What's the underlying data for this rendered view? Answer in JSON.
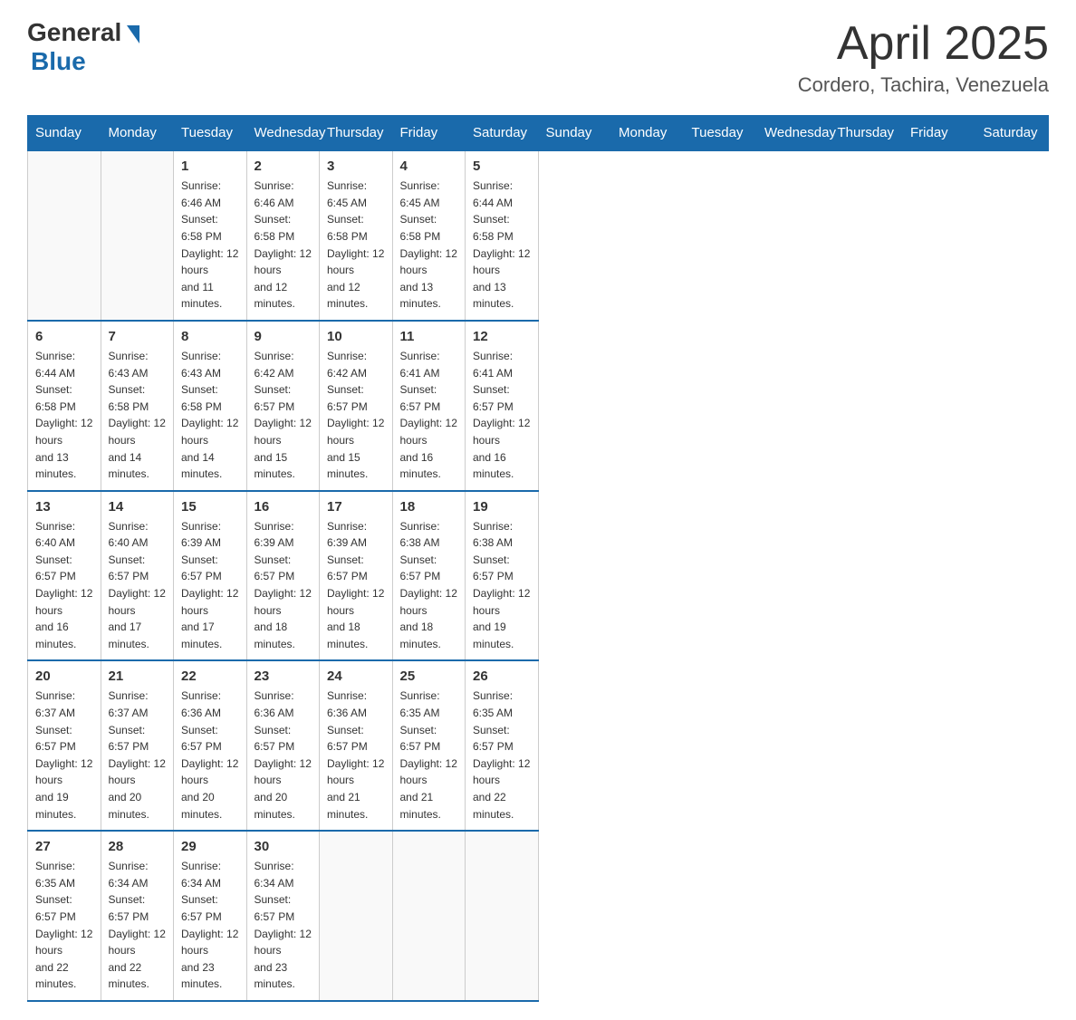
{
  "header": {
    "logo_general": "General",
    "logo_blue": "Blue",
    "month": "April 2025",
    "location": "Cordero, Tachira, Venezuela"
  },
  "days_of_week": [
    "Sunday",
    "Monday",
    "Tuesday",
    "Wednesday",
    "Thursday",
    "Friday",
    "Saturday"
  ],
  "weeks": [
    [
      {
        "day": "",
        "info": ""
      },
      {
        "day": "",
        "info": ""
      },
      {
        "day": "1",
        "info": "Sunrise: 6:46 AM\nSunset: 6:58 PM\nDaylight: 12 hours\nand 11 minutes."
      },
      {
        "day": "2",
        "info": "Sunrise: 6:46 AM\nSunset: 6:58 PM\nDaylight: 12 hours\nand 12 minutes."
      },
      {
        "day": "3",
        "info": "Sunrise: 6:45 AM\nSunset: 6:58 PM\nDaylight: 12 hours\nand 12 minutes."
      },
      {
        "day": "4",
        "info": "Sunrise: 6:45 AM\nSunset: 6:58 PM\nDaylight: 12 hours\nand 13 minutes."
      },
      {
        "day": "5",
        "info": "Sunrise: 6:44 AM\nSunset: 6:58 PM\nDaylight: 12 hours\nand 13 minutes."
      }
    ],
    [
      {
        "day": "6",
        "info": "Sunrise: 6:44 AM\nSunset: 6:58 PM\nDaylight: 12 hours\nand 13 minutes."
      },
      {
        "day": "7",
        "info": "Sunrise: 6:43 AM\nSunset: 6:58 PM\nDaylight: 12 hours\nand 14 minutes."
      },
      {
        "day": "8",
        "info": "Sunrise: 6:43 AM\nSunset: 6:58 PM\nDaylight: 12 hours\nand 14 minutes."
      },
      {
        "day": "9",
        "info": "Sunrise: 6:42 AM\nSunset: 6:57 PM\nDaylight: 12 hours\nand 15 minutes."
      },
      {
        "day": "10",
        "info": "Sunrise: 6:42 AM\nSunset: 6:57 PM\nDaylight: 12 hours\nand 15 minutes."
      },
      {
        "day": "11",
        "info": "Sunrise: 6:41 AM\nSunset: 6:57 PM\nDaylight: 12 hours\nand 16 minutes."
      },
      {
        "day": "12",
        "info": "Sunrise: 6:41 AM\nSunset: 6:57 PM\nDaylight: 12 hours\nand 16 minutes."
      }
    ],
    [
      {
        "day": "13",
        "info": "Sunrise: 6:40 AM\nSunset: 6:57 PM\nDaylight: 12 hours\nand 16 minutes."
      },
      {
        "day": "14",
        "info": "Sunrise: 6:40 AM\nSunset: 6:57 PM\nDaylight: 12 hours\nand 17 minutes."
      },
      {
        "day": "15",
        "info": "Sunrise: 6:39 AM\nSunset: 6:57 PM\nDaylight: 12 hours\nand 17 minutes."
      },
      {
        "day": "16",
        "info": "Sunrise: 6:39 AM\nSunset: 6:57 PM\nDaylight: 12 hours\nand 18 minutes."
      },
      {
        "day": "17",
        "info": "Sunrise: 6:39 AM\nSunset: 6:57 PM\nDaylight: 12 hours\nand 18 minutes."
      },
      {
        "day": "18",
        "info": "Sunrise: 6:38 AM\nSunset: 6:57 PM\nDaylight: 12 hours\nand 18 minutes."
      },
      {
        "day": "19",
        "info": "Sunrise: 6:38 AM\nSunset: 6:57 PM\nDaylight: 12 hours\nand 19 minutes."
      }
    ],
    [
      {
        "day": "20",
        "info": "Sunrise: 6:37 AM\nSunset: 6:57 PM\nDaylight: 12 hours\nand 19 minutes."
      },
      {
        "day": "21",
        "info": "Sunrise: 6:37 AM\nSunset: 6:57 PM\nDaylight: 12 hours\nand 20 minutes."
      },
      {
        "day": "22",
        "info": "Sunrise: 6:36 AM\nSunset: 6:57 PM\nDaylight: 12 hours\nand 20 minutes."
      },
      {
        "day": "23",
        "info": "Sunrise: 6:36 AM\nSunset: 6:57 PM\nDaylight: 12 hours\nand 20 minutes."
      },
      {
        "day": "24",
        "info": "Sunrise: 6:36 AM\nSunset: 6:57 PM\nDaylight: 12 hours\nand 21 minutes."
      },
      {
        "day": "25",
        "info": "Sunrise: 6:35 AM\nSunset: 6:57 PM\nDaylight: 12 hours\nand 21 minutes."
      },
      {
        "day": "26",
        "info": "Sunrise: 6:35 AM\nSunset: 6:57 PM\nDaylight: 12 hours\nand 22 minutes."
      }
    ],
    [
      {
        "day": "27",
        "info": "Sunrise: 6:35 AM\nSunset: 6:57 PM\nDaylight: 12 hours\nand 22 minutes."
      },
      {
        "day": "28",
        "info": "Sunrise: 6:34 AM\nSunset: 6:57 PM\nDaylight: 12 hours\nand 22 minutes."
      },
      {
        "day": "29",
        "info": "Sunrise: 6:34 AM\nSunset: 6:57 PM\nDaylight: 12 hours\nand 23 minutes."
      },
      {
        "day": "30",
        "info": "Sunrise: 6:34 AM\nSunset: 6:57 PM\nDaylight: 12 hours\nand 23 minutes."
      },
      {
        "day": "",
        "info": ""
      },
      {
        "day": "",
        "info": ""
      },
      {
        "day": "",
        "info": ""
      }
    ]
  ]
}
